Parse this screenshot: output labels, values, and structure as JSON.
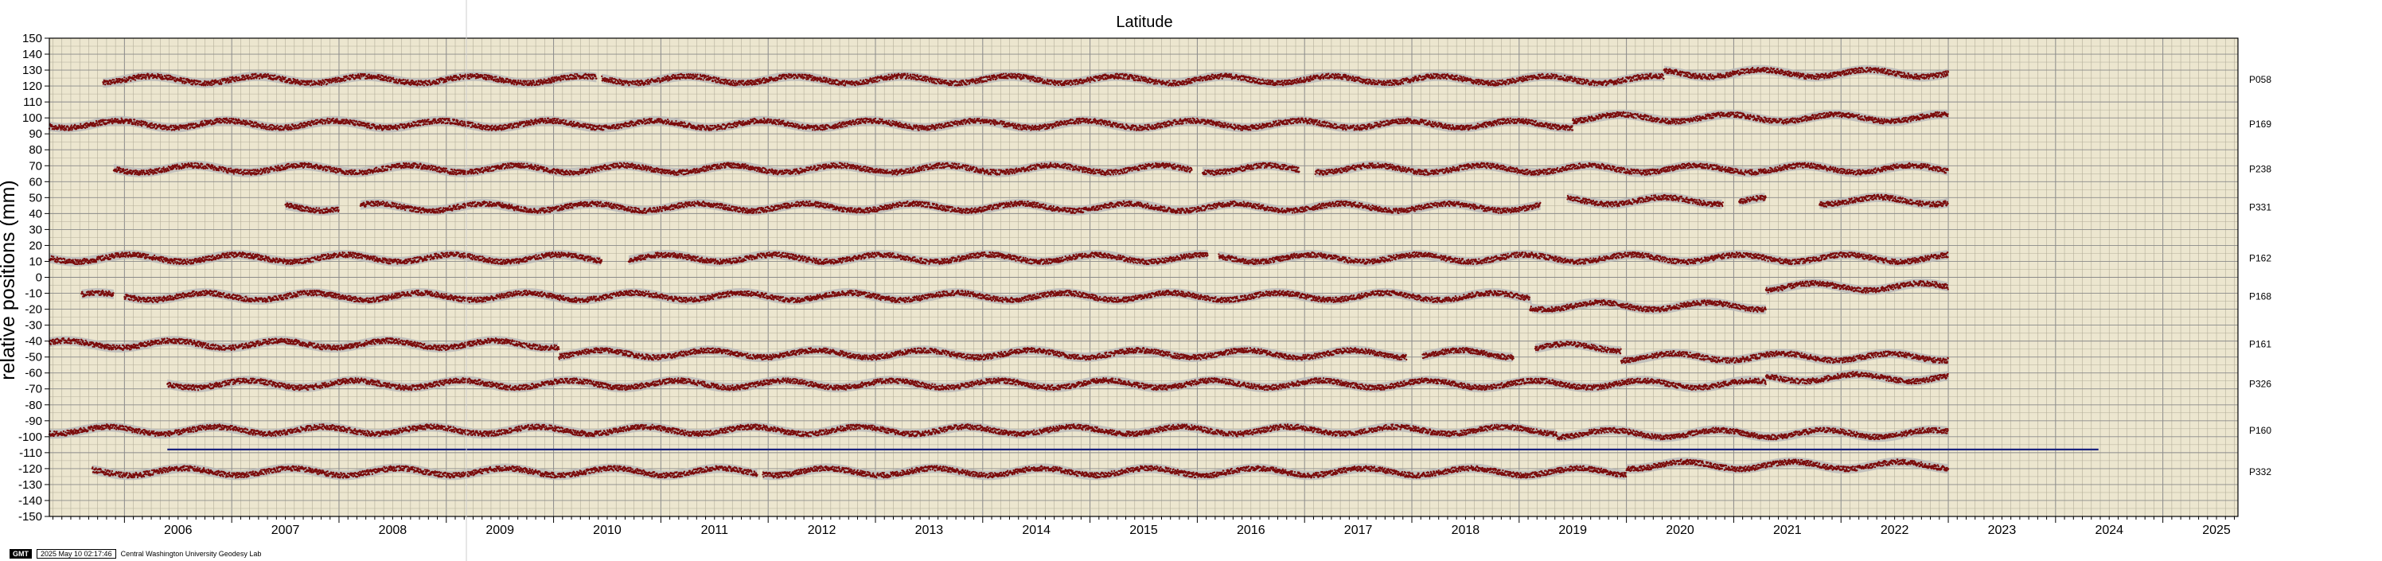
{
  "chart_data": {
    "type": "scatter",
    "title": "Latitude",
    "ylabel": "relative positions (mm)",
    "xlabel": "",
    "ylim": [
      -150,
      150
    ],
    "xlim": [
      2005.3,
      2025.7
    ],
    "grid": true,
    "y_ticks": [
      -150,
      -140,
      -130,
      -120,
      -110,
      -100,
      -90,
      -80,
      -70,
      -60,
      -50,
      -40,
      -30,
      -20,
      -10,
      0,
      10,
      20,
      30,
      40,
      50,
      60,
      70,
      80,
      90,
      100,
      110,
      120,
      130,
      140,
      150
    ],
    "x_ticks": [
      2006,
      2007,
      2008,
      2009,
      2010,
      2011,
      2012,
      2013,
      2014,
      2015,
      2016,
      2017,
      2018,
      2019,
      2020,
      2021,
      2022,
      2023,
      2024,
      2025
    ],
    "point_color": "#7a0a0a",
    "band_color": "#b8b8b8",
    "background_color": "#ece6cf",
    "reference_line": {
      "y": -108,
      "x_start": 2006.4,
      "x_end": 2024.4,
      "color": "#1a237e"
    },
    "series": [
      {
        "name": "P058",
        "level": 124,
        "segments": [
          [
            2005.8,
            2010.4
          ],
          [
            2010.45,
            2020.35
          ],
          [
            2020.35,
            2023.0
          ]
        ],
        "offsets": [
          [
            2020.35,
            4
          ]
        ]
      },
      {
        "name": "P169",
        "level": 96,
        "segments": [
          [
            2005.3,
            2019.5
          ],
          [
            2019.5,
            2023.0
          ]
        ],
        "offsets": [
          [
            2019.5,
            4
          ]
        ]
      },
      {
        "name": "P238",
        "level": 68,
        "segments": [
          [
            2005.9,
            2015.95
          ],
          [
            2016.05,
            2016.95
          ],
          [
            2017.1,
            2023.0
          ]
        ],
        "offsets": []
      },
      {
        "name": "P331",
        "level": 44,
        "segments": [
          [
            2007.5,
            2008.0
          ],
          [
            2008.2,
            2019.2
          ],
          [
            2019.45,
            2020.9
          ],
          [
            2021.05,
            2021.3
          ],
          [
            2021.8,
            2023.0
          ]
        ],
        "offsets": [
          [
            2019.2,
            4
          ]
        ]
      },
      {
        "name": "P162",
        "level": 12,
        "segments": [
          [
            2005.3,
            2010.45
          ],
          [
            2010.7,
            2016.1
          ],
          [
            2016.2,
            2023.0
          ]
        ],
        "offsets": []
      },
      {
        "name": "P168",
        "level": -12,
        "segments": [
          [
            2005.6,
            2005.9
          ],
          [
            2006.0,
            2021.3
          ],
          [
            2021.3,
            2023.0
          ]
        ],
        "offsets": [
          [
            2019.1,
            -6
          ],
          [
            2021.3,
            12
          ]
        ]
      },
      {
        "name": "P161",
        "level": -42,
        "segments": [
          [
            2005.3,
            2010.05
          ],
          [
            2010.05,
            2017.95
          ],
          [
            2018.1,
            2018.95
          ],
          [
            2019.15,
            2019.95
          ],
          [
            2019.95,
            2023.0
          ]
        ],
        "offsets": [
          [
            2010.05,
            -6
          ],
          [
            2019.15,
            4
          ],
          [
            2019.95,
            -6
          ]
        ]
      },
      {
        "name": "P326",
        "level": -67,
        "segments": [
          [
            2006.4,
            2021.3
          ],
          [
            2021.3,
            2023.0
          ]
        ],
        "offsets": [
          [
            2021.3,
            4
          ]
        ]
      },
      {
        "name": "P160",
        "level": -96,
        "segments": [
          [
            2005.3,
            2019.35
          ],
          [
            2019.35,
            2023.0
          ]
        ],
        "offsets": [
          [
            2019.35,
            -2
          ]
        ]
      },
      {
        "name": "P332",
        "level": -122,
        "segments": [
          [
            2005.7,
            2011.9
          ],
          [
            2011.95,
            2020.0
          ],
          [
            2020.0,
            2023.0
          ]
        ],
        "offsets": [
          [
            2020.0,
            4
          ]
        ]
      }
    ]
  },
  "footer": {
    "logo": "GMT",
    "timestamp": "2025 May 10 02:17:46",
    "credit": "Central Washington University Geodesy Lab"
  }
}
